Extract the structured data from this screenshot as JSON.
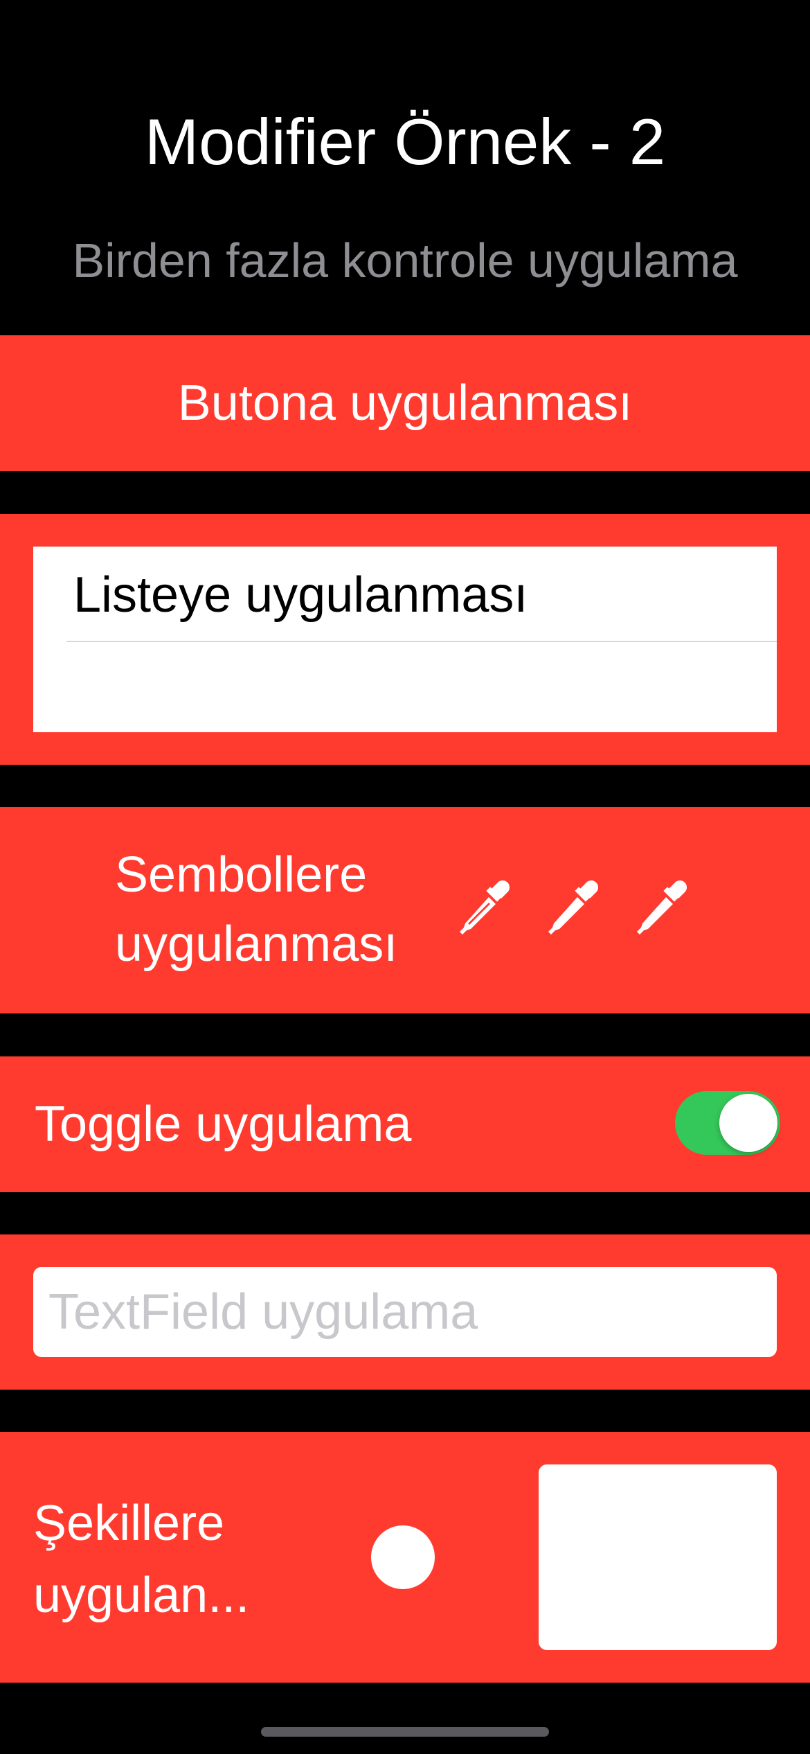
{
  "header": {
    "title": "Modifier Örnek - 2",
    "subtitle": "Birden fazla kontrole uygulama"
  },
  "button_section": {
    "label": "Butona uygulanması"
  },
  "list_section": {
    "rows": [
      "Listeye uygulanması"
    ]
  },
  "symbols_section": {
    "label_line1": "Sembollere",
    "label_line2": "uygulanması",
    "icons": [
      "eyedropper-icon",
      "eyedropper-icon",
      "eyedropper-icon"
    ]
  },
  "toggle_section": {
    "label": "Toggle uygulama",
    "is_on": true
  },
  "textfield_section": {
    "value": "",
    "placeholder": "TextField uygulama"
  },
  "shapes_section": {
    "label_line1": "Şekillere",
    "label_line2": "uygulan..."
  },
  "colors": {
    "background": "#000000",
    "band": "#ff3b30",
    "toggle_on": "#34c759",
    "subtitle": "#8e8e93",
    "placeholder": "#c7c7cc"
  }
}
